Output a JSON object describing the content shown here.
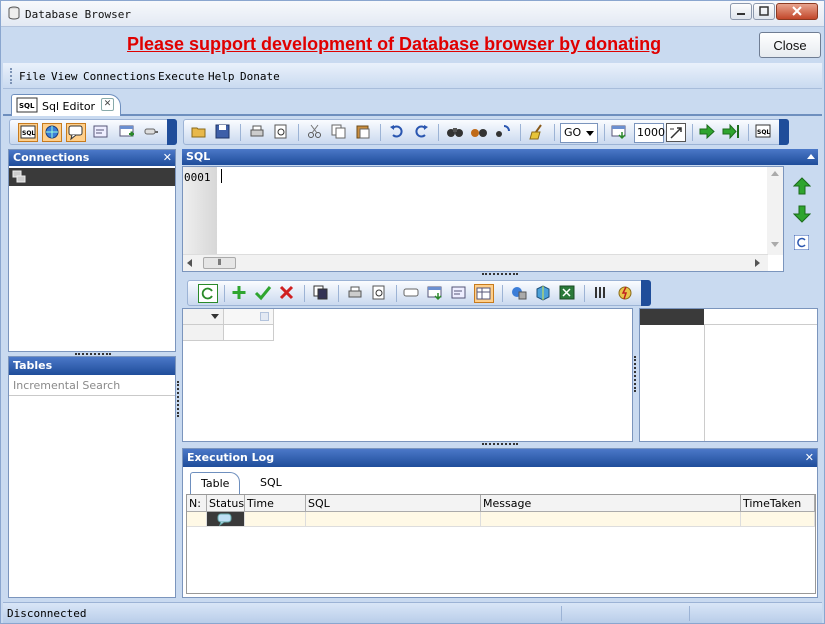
{
  "window": {
    "title": "Database Browser"
  },
  "banner": {
    "donate_text": "Please support development of Database browser by donating",
    "close_label": "Close"
  },
  "menu": {
    "items": [
      "File",
      "View",
      "Connections",
      "Execute",
      "Help",
      "Donate"
    ]
  },
  "doc_tab": {
    "label": "Sql Editor"
  },
  "connections": {
    "title": "Connections"
  },
  "tables": {
    "title": "Tables",
    "search_placeholder": "Incremental Search"
  },
  "sql": {
    "title": "SQL",
    "line_number": "0001"
  },
  "toolbar": {
    "go_value": "GO",
    "limit_value": "1000"
  },
  "log": {
    "title": "Execution Log",
    "tabs": [
      "Table",
      "SQL"
    ],
    "columns": [
      "N:",
      "Status",
      "Time",
      "SQL",
      "Message",
      "TimeTaken"
    ]
  },
  "status": {
    "text": "Disconnected"
  },
  "colors": {
    "accent": "#1f4d9a",
    "window_bg": "#c9daf0",
    "donate": "#e00000"
  }
}
